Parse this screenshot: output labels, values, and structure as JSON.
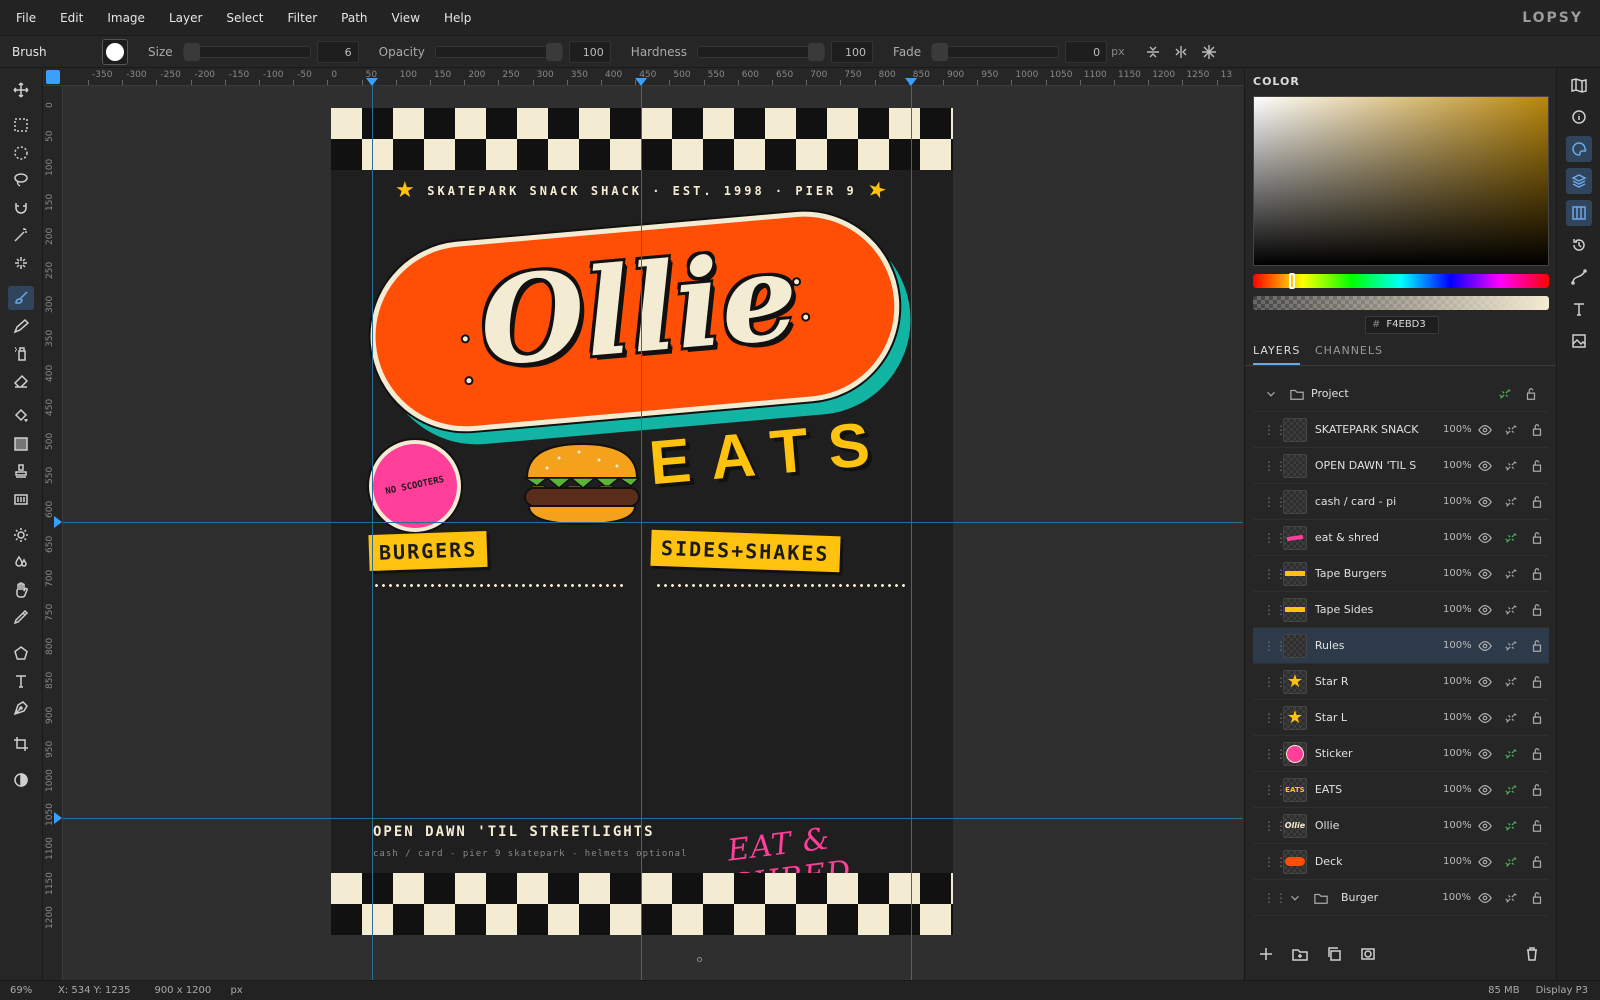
{
  "app": {
    "logo": "LOPSY"
  },
  "menu": [
    "File",
    "Edit",
    "Image",
    "Layer",
    "Select",
    "Filter",
    "Path",
    "View",
    "Help"
  ],
  "options": {
    "tool_name": "Brush",
    "size_label": "Size",
    "size_value": "6",
    "opacity_label": "Opacity",
    "opacity_value": "100",
    "hardness_label": "Hardness",
    "hardness_value": "100",
    "fade_label": "Fade",
    "fade_value": "0",
    "fade_unit": "px"
  },
  "ruler": {
    "h": [
      "-350",
      "-300",
      "-250",
      "-200",
      "-150",
      "-100",
      "-50",
      "0",
      "50",
      "100",
      "150",
      "200",
      "250",
      "300",
      "350",
      "400",
      "450",
      "500",
      "550",
      "600",
      "650",
      "700",
      "750",
      "800",
      "850",
      "900",
      "950",
      "1000",
      "1050",
      "1100",
      "1150",
      "1200",
      "1250",
      "13"
    ],
    "v": [
      "0",
      "50",
      "100",
      "150",
      "200",
      "250",
      "300",
      "350",
      "400",
      "450",
      "500",
      "550",
      "600",
      "650",
      "700",
      "750",
      "800",
      "850",
      "900",
      "950",
      "1000",
      "1050",
      "1100",
      "1150",
      "1200"
    ]
  },
  "document": {
    "subtitle": "SKATEPARK SNACK SHACK · EST. 1998 · PIER 9",
    "ollie": "Ollie",
    "eats": "EATS",
    "sticker": "NO SCOOTERS",
    "tape_burgers": "BURGERS",
    "tape_sides": "SIDES+SHAKES",
    "footer_title": "OPEN DAWN 'TIL STREETLIGHTS",
    "footer_sub": "cash / card  -  pier 9 skatepark  -  helmets optional",
    "shred": "EAT & SHRED",
    "colors": {
      "cream": "#f4ebd3",
      "orange": "#ff4e05",
      "teal": "#12b5a4",
      "yellow": "#ffc20e",
      "pink": "#ff3f9a",
      "dark": "#1f1f20"
    }
  },
  "color_panel": {
    "title": "COLOR",
    "hex_label": "#",
    "hex_value": "F4EBD3"
  },
  "layers_panel": {
    "tab_layers": "LAYERS",
    "tab_channels": "CHANNELS",
    "project_group": "Project",
    "rows": [
      {
        "name": "SKATEPARK SNACK",
        "opacity": "100%",
        "thumb": "checker"
      },
      {
        "name": "OPEN DAWN 'TIL S",
        "opacity": "100%",
        "thumb": "checker"
      },
      {
        "name": "cash / card - pi",
        "opacity": "100%",
        "thumb": "checker"
      },
      {
        "name": "eat & shred",
        "opacity": "100%",
        "thumb": "pink-text"
      },
      {
        "name": "Tape Burgers",
        "opacity": "100%",
        "thumb": "tape"
      },
      {
        "name": "Tape Sides",
        "opacity": "100%",
        "thumb": "tape"
      },
      {
        "name": "Rules",
        "opacity": "100%",
        "thumb": "checker",
        "selected": true
      },
      {
        "name": "Star R",
        "opacity": "100%",
        "thumb": "star"
      },
      {
        "name": "Star L",
        "opacity": "100%",
        "thumb": "star"
      },
      {
        "name": "Sticker",
        "opacity": "100%",
        "thumb": "sticker"
      },
      {
        "name": "EATS",
        "opacity": "100%",
        "thumb": "eats"
      },
      {
        "name": "Ollie",
        "opacity": "100%",
        "thumb": "ollie"
      },
      {
        "name": "Deck",
        "opacity": "100%",
        "thumb": "deck"
      }
    ],
    "burger_group": {
      "name": "Burger",
      "opacity": "100%"
    }
  },
  "status": {
    "zoom": "69%",
    "cursor": "X: 534 Y: 1235",
    "doc_size": "900 x 1200",
    "doc_unit": "px",
    "memory": "85 MB",
    "profile": "Display P3"
  }
}
